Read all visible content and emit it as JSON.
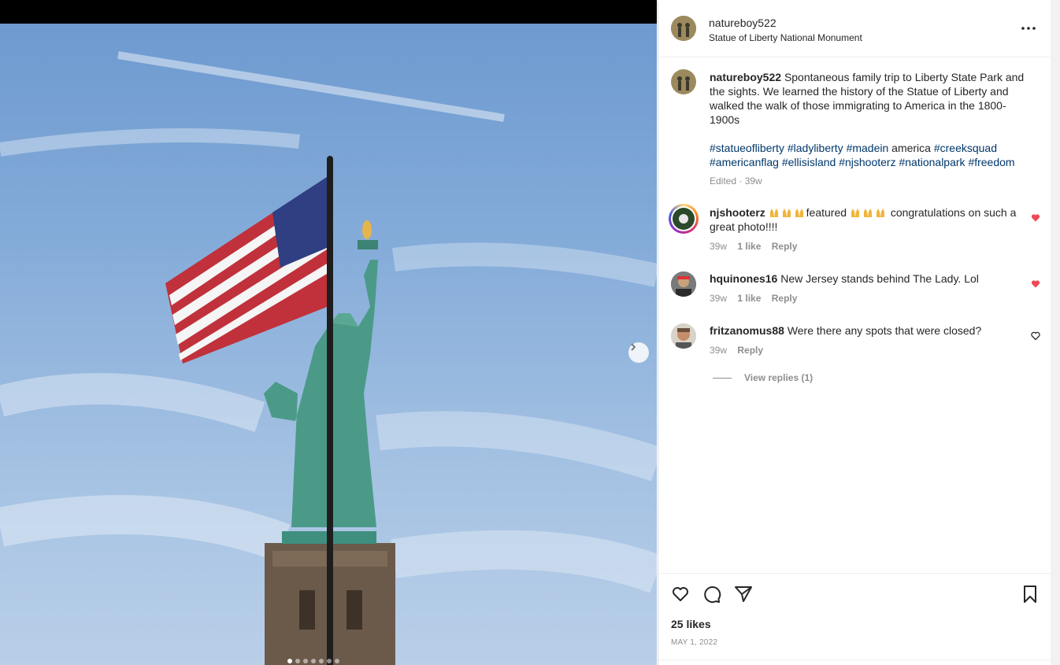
{
  "post": {
    "username": "natureboy522",
    "location": "Statue of Liberty National Monument",
    "more_icon": "more-horizontal-icon",
    "caption": "Spontaneous family trip to Liberty State Park and the sights. We learned the history of the Statue of Liberty and walked the walk of those immigrating to America in the 1800-1900s",
    "hashtags_line1": [
      "#statueofliberty",
      "#ladyliberty",
      "#madein"
    ],
    "hashtags_line1_plain": "america",
    "hashtags_line1_end": "#creeksquad",
    "hashtags_line2": [
      "#americanflag",
      "#ellisisland",
      "#njshooterz",
      "#nationalpark",
      "#freedom"
    ],
    "edited_meta": "Edited · 39w"
  },
  "comments": [
    {
      "username": "njshooterz",
      "text_part1": "featured",
      "text_part2": "congratulations on such a great photo!!!!",
      "time": "39w",
      "likes": "1 like",
      "reply": "Reply",
      "liked": true
    },
    {
      "username": "hquinones16",
      "text": "New Jersey stands behind The Lady. Lol",
      "time": "39w",
      "likes": "1 like",
      "reply": "Reply",
      "liked": true
    },
    {
      "username": "fritzanomus88",
      "text": "Were there any spots that were closed?",
      "time": "39w",
      "reply": "Reply",
      "liked": false,
      "view_replies": "View replies (1)"
    }
  ],
  "footer": {
    "likes": "25 likes",
    "date": "MAY 1, 2022",
    "icons": [
      "heart-icon",
      "comment-icon",
      "share-icon",
      "bookmark-icon"
    ]
  },
  "colors": {
    "liked_heart": "#ed4956",
    "hashtag": "#00376b",
    "muted": "#8e8e8e"
  }
}
